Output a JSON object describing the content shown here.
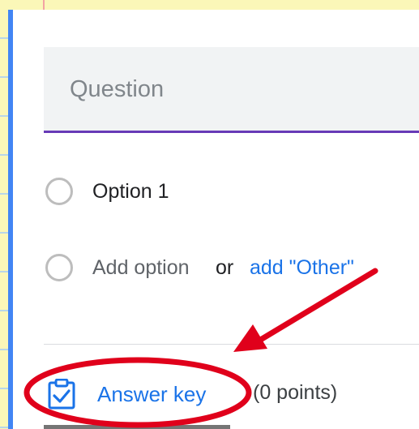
{
  "question": {
    "placeholder": "Question"
  },
  "options": [
    {
      "label": "Option 1"
    }
  ],
  "add_option": {
    "label": "Add option",
    "or_text": "or",
    "other_link": "add \"Other\""
  },
  "footer": {
    "answer_key_label": "Answer key",
    "points_label": "(0 points)"
  },
  "colors": {
    "accent_blue": "#4285f4",
    "link_blue": "#1a73e8",
    "underline_purple": "#673ab7",
    "annotation_red": "#e0001b"
  },
  "icons": {
    "answer_key": "clipboard-check-icon",
    "radio": "radio-unchecked-icon"
  }
}
